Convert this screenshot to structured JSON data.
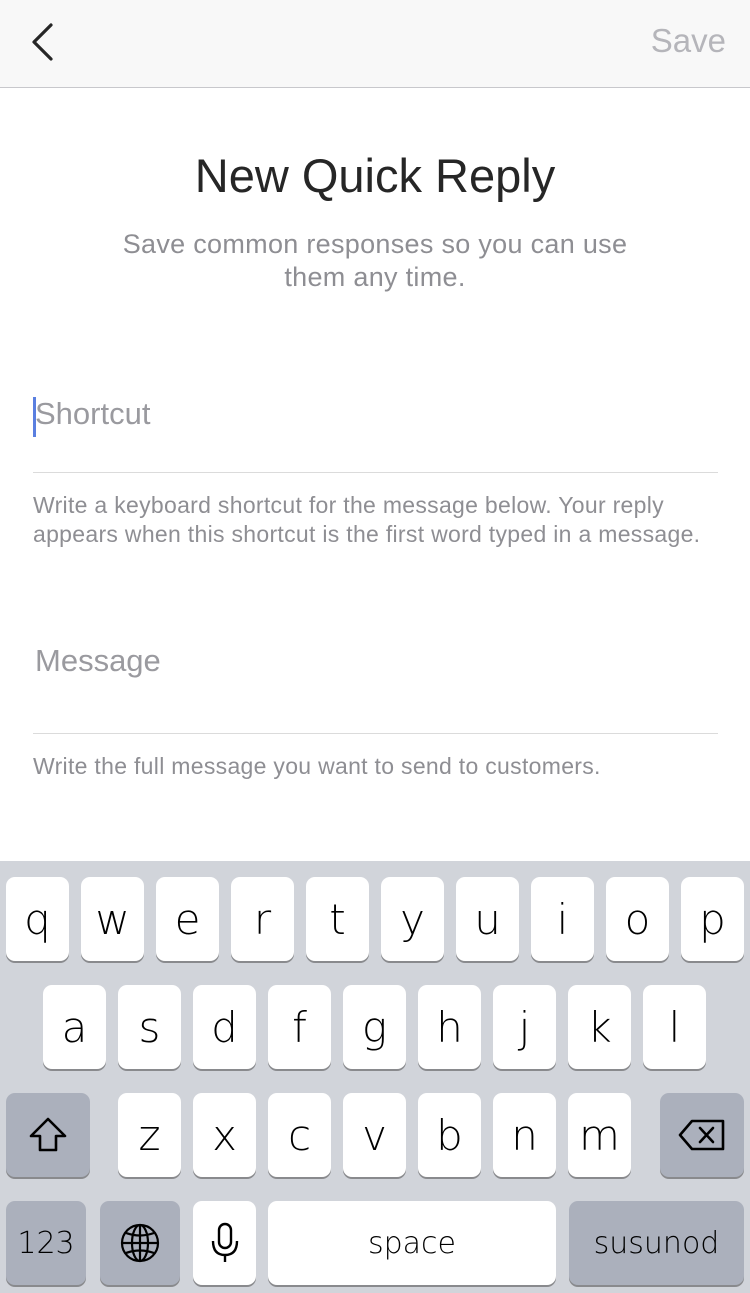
{
  "nav": {
    "save_label": "Save",
    "back_icon": "chevron-left-icon"
  },
  "header": {
    "title": "New Quick Reply",
    "subtitle": "Save common responses so you can use them any time."
  },
  "form": {
    "shortcut": {
      "placeholder": "Shortcut",
      "help": "Write a keyboard shortcut for the message below. Your reply appears when this shortcut is the first word typed in a message."
    },
    "message": {
      "placeholder": "Message",
      "help": "Write the full message you want to send to customers."
    }
  },
  "keyboard": {
    "row1": [
      "q",
      "w",
      "e",
      "r",
      "t",
      "y",
      "u",
      "i",
      "o",
      "p"
    ],
    "row2": [
      "a",
      "s",
      "d",
      "f",
      "g",
      "h",
      "j",
      "k",
      "l"
    ],
    "row3": [
      "z",
      "x",
      "c",
      "v",
      "b",
      "n",
      "m"
    ],
    "numbers_label": "123",
    "space_label": "space",
    "return_label": "susunod",
    "shift_icon": "shift-icon",
    "delete_icon": "backspace-icon",
    "globe_icon": "globe-icon",
    "mic_icon": "microphone-icon"
  },
  "colors": {
    "caret": "#5a7fe0",
    "keyboard_bg": "#d1d4da",
    "key_dark": "#abb0bc"
  }
}
